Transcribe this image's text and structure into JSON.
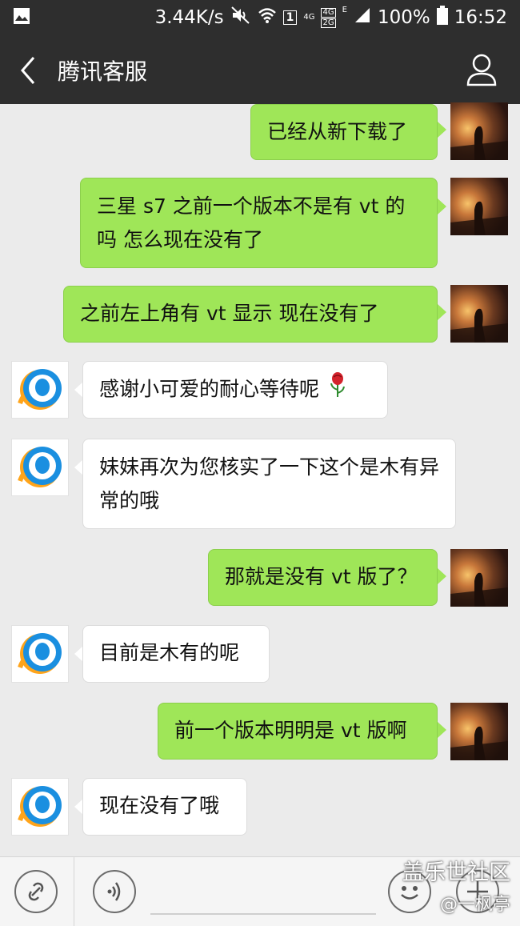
{
  "status_bar": {
    "speed": "3.44K/s",
    "network1": "4G",
    "network2a": "4G",
    "network2b": "2G",
    "e_label": "E",
    "battery": "100%",
    "time": "16:52",
    "sim": "1"
  },
  "header": {
    "title": "腾讯客服"
  },
  "messages": [
    {
      "side": "right",
      "text": "已经从新下载了"
    },
    {
      "side": "right",
      "text": "三星 s7 之前一个版本不是有 vt 的吗   怎么现在没有了"
    },
    {
      "side": "right",
      "text": "之前左上角有 vt 显示    现在没有了"
    },
    {
      "side": "left",
      "text": "感谢小可爱的耐心等待呢"
    },
    {
      "side": "left",
      "text": "妹妹再次为您核实了一下这个是木有异常的哦"
    },
    {
      "side": "right",
      "text": "那就是没有 vt 版了？"
    },
    {
      "side": "left",
      "text": "目前是木有的呢"
    },
    {
      "side": "right",
      "text": "前一个版本明明是 vt 版啊"
    },
    {
      "side": "left",
      "text": "现在没有了哦"
    }
  ],
  "watermark": {
    "line1": "盖乐世社区",
    "line2": "@一枫亭"
  },
  "icons": {
    "back": "chevron-left-icon",
    "profile": "person-icon",
    "link": "link-icon",
    "voice": "voice-icon",
    "emoji": "emoji-icon",
    "add": "plus-icon",
    "rose": "rose-icon"
  },
  "colors": {
    "header_bg": "#2e2e2e",
    "chat_bg": "#ebebeb",
    "sent_bubble": "#9fe658",
    "received_bubble": "#ffffff"
  }
}
